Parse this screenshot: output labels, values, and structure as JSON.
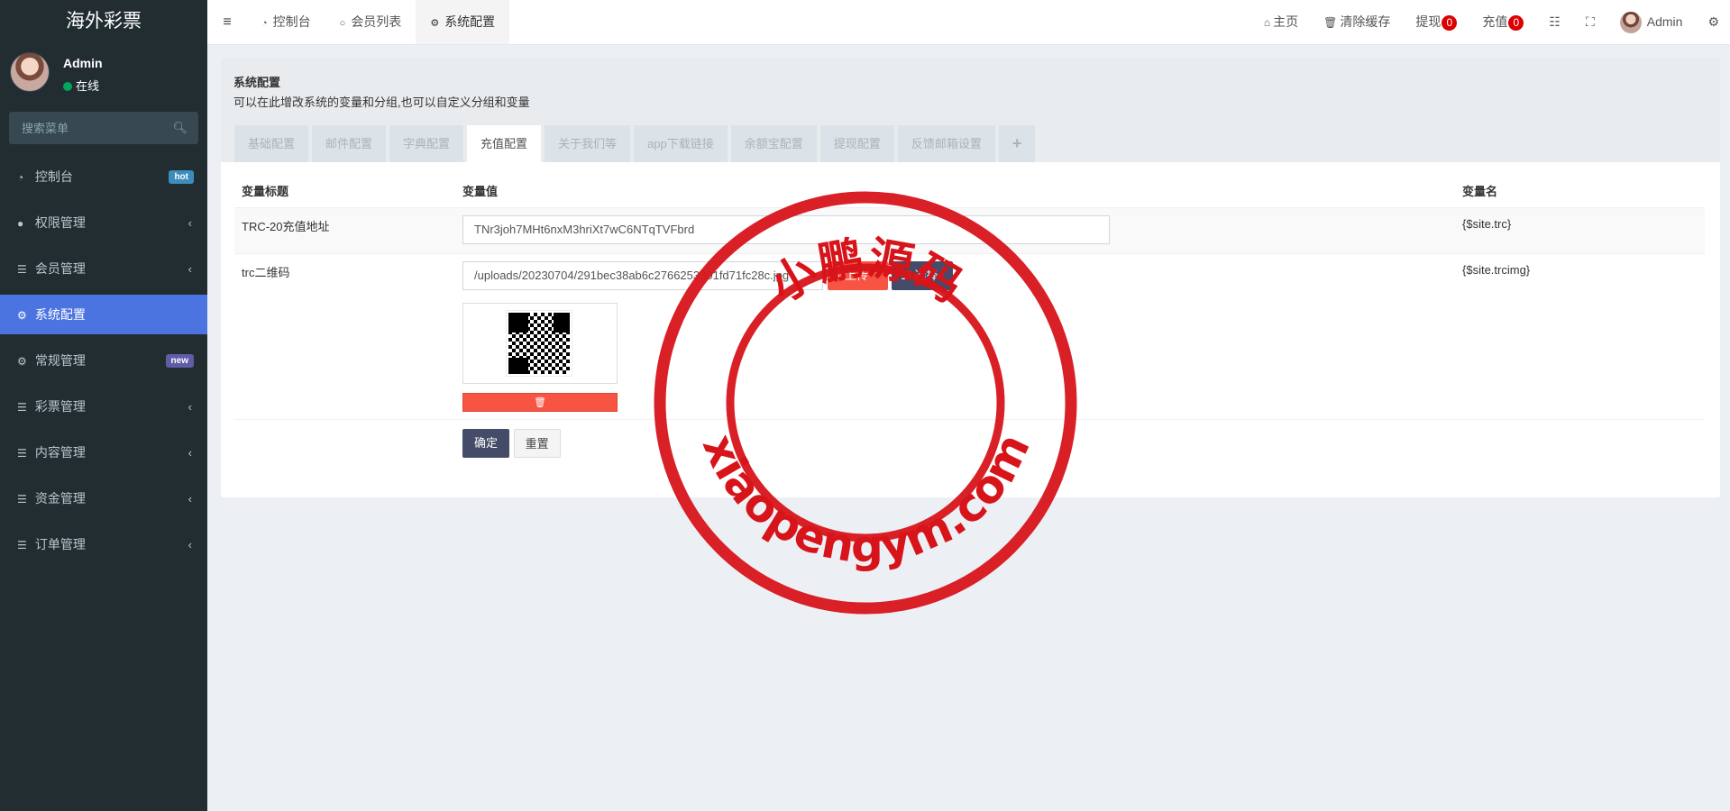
{
  "sidebar": {
    "logo": "海外彩票",
    "user": {
      "name": "Admin",
      "status": "在线"
    },
    "search_placeholder": "搜索菜单",
    "items": [
      {
        "label": "控制台",
        "icon": "dashboard-icon",
        "badge": "hot"
      },
      {
        "label": "权限管理",
        "icon": "users-icon"
      },
      {
        "label": "会员管理",
        "icon": "list-icon"
      },
      {
        "label": "系统配置",
        "icon": "gear-icon",
        "active": true
      },
      {
        "label": "常规管理",
        "icon": "cogs-icon",
        "badge": "new"
      },
      {
        "label": "彩票管理",
        "icon": "list-icon"
      },
      {
        "label": "内容管理",
        "icon": "list-icon"
      },
      {
        "label": "资金管理",
        "icon": "list-icon"
      },
      {
        "label": "订单管理",
        "icon": "list-icon"
      }
    ]
  },
  "navbar": {
    "tabs": [
      {
        "label": "控制台",
        "icon": "dashboard-icon"
      },
      {
        "label": "会员列表",
        "icon": "circle-icon"
      },
      {
        "label": "系统配置",
        "icon": "gear-icon"
      }
    ],
    "right": {
      "home": "主页",
      "clear_cache": "清除缓存",
      "withdraw": "提现",
      "withdraw_count": "0",
      "recharge": "充值",
      "recharge_count": "0",
      "user": "Admin"
    }
  },
  "content": {
    "title": "系统配置",
    "description": "可以在此增改系统的变量和分组,也可以自定义分组和变量",
    "tabs": [
      "基础配置",
      "邮件配置",
      "字典配置",
      "充值配置",
      "关于我们等",
      "app下载链接",
      "余额宝配置",
      "提现配置",
      "反馈邮箱设置",
      "+"
    ],
    "active_tab": "充值配置",
    "table": {
      "headers": [
        "变量标题",
        "变量值",
        "变量名"
      ],
      "rows": [
        {
          "title": "TRC-20充值地址",
          "value": "TNr3joh7MHt6nxM3hriXt7wC6NTqTVFbrd",
          "name": "{$site.trc}"
        },
        {
          "title": "trc二维码",
          "value": "/uploads/20230704/291bec38ab6c2766253301fd71fc28c.jpg",
          "name": "{$site.trcimg}"
        }
      ],
      "upload_label": "上传",
      "choose_label": "选择",
      "confirm": "确定",
      "reset": "重置"
    }
  },
  "watermark": {
    "top_text": "小鹏源码",
    "bottom_text": "xiaopengym.com",
    "color": "#d7141a"
  }
}
